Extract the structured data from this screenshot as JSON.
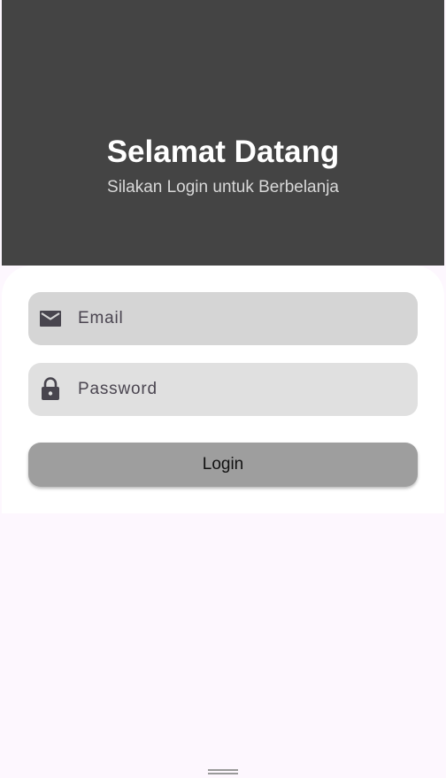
{
  "header": {
    "title": "Selamat Datang",
    "subtitle": "Silakan Login untuk Berbelanja"
  },
  "form": {
    "email": {
      "placeholder": "Email",
      "icon": "mail-icon"
    },
    "password": {
      "placeholder": "Password",
      "icon": "lock-icon"
    },
    "login_label": "Login"
  },
  "colors": {
    "header_bg": "#444444",
    "page_bg": "#fdf7fe",
    "email_field_bg": "#d5d5d5",
    "password_field_bg": "#e0e0e0",
    "button_bg": "#9e9e9e",
    "icon": "#48454e"
  }
}
